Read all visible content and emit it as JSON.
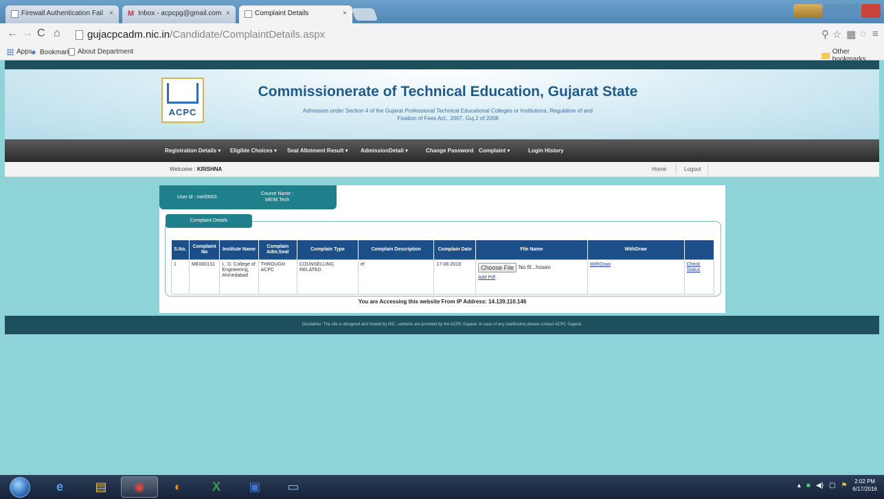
{
  "browser": {
    "tabs": [
      {
        "title": "Firewall Authentication Fail"
      },
      {
        "title": "Inbox - acpcpg@gmail.com"
      },
      {
        "title": "Complaint Details"
      }
    ],
    "url_host": "gujacpcadm.nic.in",
    "url_path": "/Candidate/ComplaintDetails.aspx",
    "bookmarks": [
      "Apps",
      "Bookmarks",
      "About Department"
    ],
    "other_bookmarks": "Other bookmarks"
  },
  "site": {
    "logo_text": "ACPC",
    "title": "Commissionerate of Technical Education, Gujarat State",
    "subtitle_line1": "Admission under Section 4 of the Gujarat Professional Technical Educational Colleges or Institutions, Regulation of and",
    "subtitle_line2": "Fixation of Fees Act., 2007, Guj.2 of 2008"
  },
  "menu": [
    "Registration Details ▾",
    "Eligible Choices ▾",
    "Seat Allotment Result ▾",
    "AdmissionDetail ▾",
    "Change Password",
    "Complaint ▾",
    "Login History"
  ],
  "welcome": {
    "prefix": "Welcome :",
    "user": "KRISHNA",
    "home": "Home",
    "logout": "Logout"
  },
  "user_info": {
    "user_id": "User Id : me00003",
    "course_label": "Course Name :",
    "course_value": "ME/M.Tech"
  },
  "section_title": "Complaint Details",
  "table": {
    "headers": [
      "S.No.",
      "Complaint No",
      "Institute Name",
      "Complain Adm.Seat",
      "Complain Type",
      "Complain Description",
      "Complain Date",
      "File Name",
      "WithDraw",
      ""
    ],
    "rows": [
      {
        "sno": "1",
        "complaint_no": "ME000131",
        "institute": "L. D. College of Engineering, Ahmedabad",
        "adm_seat": "THROUGH ACPC",
        "type": "COUNSELLING RELATED",
        "description": "ef",
        "date": "17-06-2016",
        "choose_file": "Choose File",
        "no_file": "No fil...hosen",
        "add_pdf": "Add Pdf",
        "withdraw": "WithDraw",
        "check_status": "Check Status"
      }
    ]
  },
  "ip_text": "You are Accessing this website From IP Address: 14.139.110.146",
  "disclaimer": "Disclaimer: The site is designed and hosted by NIC, contents are provided by the ACPC Gujarat. In case of any clarification please contact ACPC Gujarat.",
  "taskbar": {
    "time": "2:02 PM",
    "date": "6/17/2016"
  }
}
